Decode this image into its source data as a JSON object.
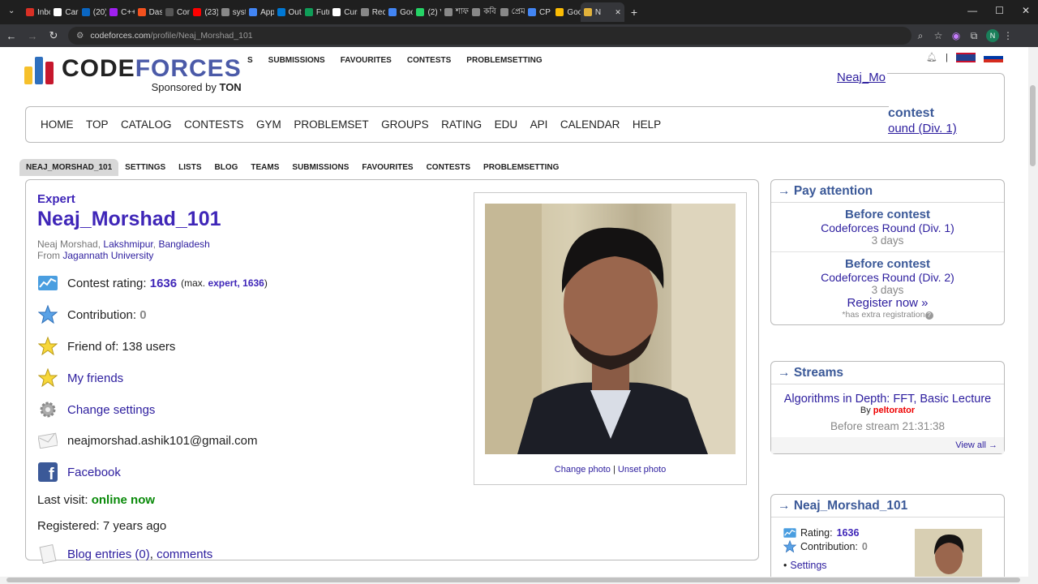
{
  "browser": {
    "tabs": [
      {
        "label": "Inbo",
        "color": "#d93025"
      },
      {
        "label": "Care",
        "color": "#ffffff"
      },
      {
        "label": "(20)",
        "color": "#0a66c2"
      },
      {
        "label": "C++",
        "color": "#a020f0"
      },
      {
        "label": "Dash",
        "color": "#f4511e"
      },
      {
        "label": "Com",
        "color": "#555555"
      },
      {
        "label": "(23)",
        "color": "#ff0000"
      },
      {
        "label": "syste",
        "color": "#888888"
      },
      {
        "label": "Appl",
        "color": "#4285f4"
      },
      {
        "label": "Outl",
        "color": "#0078d4"
      },
      {
        "label": "Futu",
        "color": "#0f9d58"
      },
      {
        "label": "Curs",
        "color": "#ffffff"
      },
      {
        "label": "Recr",
        "color": "#888888"
      },
      {
        "label": "Goo",
        "color": "#4285f4"
      },
      {
        "label": "(2) V",
        "color": "#25d366"
      },
      {
        "label": "শাফা",
        "color": "#888888"
      },
      {
        "label": "কবি",
        "color": "#888888"
      },
      {
        "label": "প্রেম",
        "color": "#888888"
      },
      {
        "label": "CP C",
        "color": "#4285f4"
      },
      {
        "label": "Goo",
        "color": "#fbbc04"
      },
      {
        "label": "N",
        "color": "#e2b23b"
      }
    ],
    "url_host": "codeforces.com",
    "url_path": "/profile/Neaj_Morshad_101",
    "profile_initial": "N"
  },
  "logo": {
    "word_a": "CODE",
    "word_b": "FORCES",
    "sponsored_prefix": "Sponsored by",
    "sponsor": "TON",
    "bar_colors": [
      "#f6c02b",
      "#2e6fbe",
      "#c6172d"
    ]
  },
  "header": {
    "ghost_menu": [
      "S",
      "SUBMISSIONS",
      "FAVOURITES",
      "CONTESTS",
      "PROBLEMSETTING"
    ],
    "handle": "Neaj_Mo",
    "contest_title": "contest",
    "contest_link": "ound (Div. 1)"
  },
  "main_menu": [
    "HOME",
    "TOP",
    "CATALOG",
    "CONTESTS",
    "GYM",
    "PROBLEMSET",
    "GROUPS",
    "RATING",
    "EDU",
    "API",
    "CALENDAR",
    "HELP"
  ],
  "sub_nav": [
    "NEAJ_MORSHAD_101",
    "SETTINGS",
    "LISTS",
    "BLOG",
    "TEAMS",
    "SUBMISSIONS",
    "FAVOURITES",
    "CONTESTS",
    "PROBLEMSETTING"
  ],
  "profile": {
    "rank": "Expert",
    "handle": "Neaj_Morshad_101",
    "real_name": "Neaj Morshad,",
    "city": "Lakshmipur",
    "country": "Bangladesh",
    "from_prefix": "From",
    "organization": "Jagannath University",
    "rating_label": "Contest rating:",
    "rating_value": "1636",
    "rating_max_prefix": "(max.",
    "rating_max_value": "expert, 1636",
    "rating_max_suffix": ")",
    "contribution_label": "Contribution:",
    "contribution_value": "0",
    "friend_of": "Friend of: 138 users",
    "my_friends": "My friends",
    "change_settings": "Change settings",
    "email": "neajmorshad.ashik101@gmail.com",
    "facebook": "Facebook",
    "last_visit_label": "Last visit:",
    "last_visit_value": "online now",
    "registered": "Registered: 7 years ago",
    "blog_entries": "Blog entries (0)",
    "comments": "comments",
    "change_photo": "Change photo",
    "unset_photo": "Unset photo",
    "separator": "|"
  },
  "sidebar": {
    "pay_attention": {
      "title": "Pay attention",
      "contest1_heading": "Before contest",
      "contest1_name": "Codeforces Round (Div. 1)",
      "contest1_time": "3 days",
      "contest2_heading": "Before contest",
      "contest2_name": "Codeforces Round (Div. 2)",
      "contest2_time": "3 days",
      "register": "Register now »",
      "note": "*has extra registration"
    },
    "streams": {
      "title": "Streams",
      "stream_title": "Algorithms in Depth: FFT, Basic Lecture",
      "by_prefix": "By",
      "author": "peltorator",
      "time": "Before stream 21:31:38",
      "view_all": "View all →"
    },
    "user_box": {
      "title": "Neaj_Morshad_101",
      "rating_label": "Rating:",
      "rating_value": "1636",
      "contribution_label": "Contribution:",
      "contribution_value": "0",
      "settings": "Settings"
    }
  },
  "arrow": "→"
}
